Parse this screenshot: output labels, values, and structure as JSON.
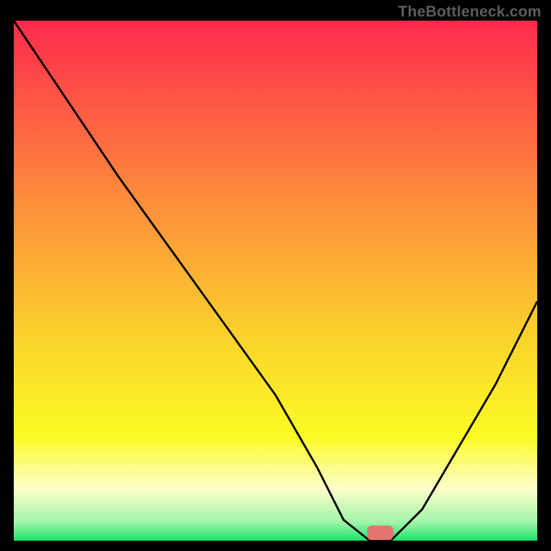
{
  "watermark": "TheBottleneck.com",
  "colors": {
    "gradient_top": "#fe2a4c",
    "gradient_mid1": "#fd8e3b",
    "gradient_mid2": "#fbd52b",
    "gradient_yellow": "#fbfb24",
    "gradient_lightyellow": "#fdfecb",
    "gradient_green": "#1be269",
    "curve": "#000000",
    "marker": "#e3746e",
    "frame": "#000000"
  },
  "chart_data": {
    "type": "line",
    "title": "",
    "xlabel": "",
    "ylabel": "",
    "xlim": [
      0,
      100
    ],
    "ylim": [
      0,
      100
    ],
    "series": [
      {
        "name": "bottleneck-curve",
        "x": [
          0,
          12,
          20,
          30,
          40,
          50,
          58,
          63,
          68,
          72,
          78,
          85,
          92,
          100
        ],
        "values": [
          100,
          82,
          70,
          56,
          42,
          28,
          14,
          4,
          0,
          0,
          6,
          18,
          30,
          46
        ]
      }
    ],
    "marker": {
      "x": 70,
      "y": 0,
      "width": 5,
      "height": 2.5
    },
    "gradient_stops": [
      {
        "pos": 0.0,
        "color": "#fe2a4c"
      },
      {
        "pos": 0.35,
        "color": "#fd8e3b"
      },
      {
        "pos": 0.62,
        "color": "#fbd52b"
      },
      {
        "pos": 0.8,
        "color": "#fbfb24"
      },
      {
        "pos": 0.9,
        "color": "#fdfecb"
      },
      {
        "pos": 0.965,
        "color": "#9ff6a9"
      },
      {
        "pos": 1.0,
        "color": "#1be269"
      }
    ]
  }
}
